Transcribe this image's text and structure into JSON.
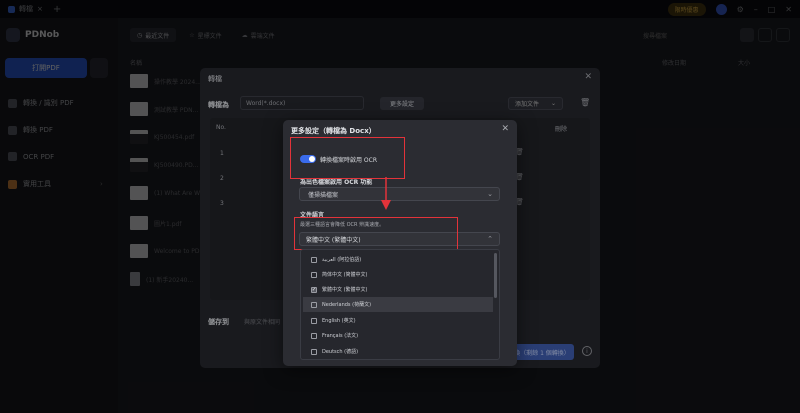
{
  "titlebar": {
    "tab_label": "轉檔",
    "add_tab": "+",
    "offer": "限時優惠",
    "icons": [
      "settings-icon",
      "minimize-icon",
      "maximize-icon",
      "close-icon"
    ]
  },
  "sidebar": {
    "app_name": "PDNob",
    "new_button": "打開PDF",
    "items": [
      {
        "icon": "convert-icon",
        "label": "轉換 / 識別 PDF"
      },
      {
        "icon": "edit-icon",
        "label": "轉換 PDF"
      },
      {
        "icon": "ocr-icon",
        "label": "OCR PDF"
      },
      {
        "icon": "toolbox-icon",
        "label": "實用工具"
      }
    ]
  },
  "main": {
    "tabs": [
      {
        "icon": "clock-icon",
        "label": "最近文件"
      },
      {
        "icon": "star-icon",
        "label": "星標文件"
      },
      {
        "icon": "cloud-icon",
        "label": "雲端文件"
      }
    ],
    "search_placeholder": "搜尋檔案",
    "columns": {
      "name": "名稱",
      "modified": "修改日期",
      "size": "大小"
    },
    "files": [
      {
        "name": "操作教學 2024...",
        "thumb": "doc"
      },
      {
        "name": "測試教學 PDN...",
        "thumb": "doc"
      },
      {
        "name": "KJ500454.pdf",
        "thumb": "dark"
      },
      {
        "name": "KJ500490.PD...",
        "thumb": "dark"
      },
      {
        "name": "(1) What Are W...",
        "thumb": "doc"
      },
      {
        "name": "圖片1.pdf",
        "thumb": "doc"
      },
      {
        "name": "Welcome to PD...",
        "thumb": "doc"
      },
      {
        "name": "(1) 新手20240...",
        "thumb": "file"
      }
    ]
  },
  "convert_dialog": {
    "title": "轉檔",
    "convert_to_label": "轉檔為",
    "format_value": "Word(*.docx)",
    "more_settings_button": "更多設定",
    "add_file_button": "添加文件",
    "table_headers": {
      "no": "No.",
      "operation": "刪除"
    },
    "rows": [
      "1",
      "2",
      "3"
    ],
    "save_to_label": "儲存到",
    "save_to_placeholder": "與原文件相同",
    "convert_button": "轉換（剩餘 1 個轉換）"
  },
  "more_settings_dialog": {
    "title": "更多設定（轉檔為 Docx）",
    "ocr_toggle_label": "轉換檔案時啟用 OCR",
    "ocr_toggle_on": true,
    "ocr_feature_label": "為出色檔案啟用 OCR 功能",
    "ocr_feature_value": "僅掃描檔案",
    "doc_language_label": "文件語言",
    "doc_language_help": "最選三種語言會降低 OCR 辨識速度。",
    "doc_language_value": "繁體中文 (繁體中文)",
    "language_options": [
      {
        "label": "العربية (阿拉伯語)",
        "checked": false
      },
      {
        "label": "简体中文 (简體中文)",
        "checked": false
      },
      {
        "label": "繁體中文 (繁體中文)",
        "checked": true
      },
      {
        "label": "Nederlands (荷蘭文)",
        "checked": false,
        "highlighted": true
      },
      {
        "label": "English (英文)",
        "checked": false
      },
      {
        "label": "Français (法文)",
        "checked": false
      },
      {
        "label": "Deutsch (德語)",
        "checked": false
      }
    ]
  },
  "colors": {
    "accent": "#2d5bd3",
    "toggle_on": "#3a6bec",
    "annotation_red": "#e2333a"
  }
}
